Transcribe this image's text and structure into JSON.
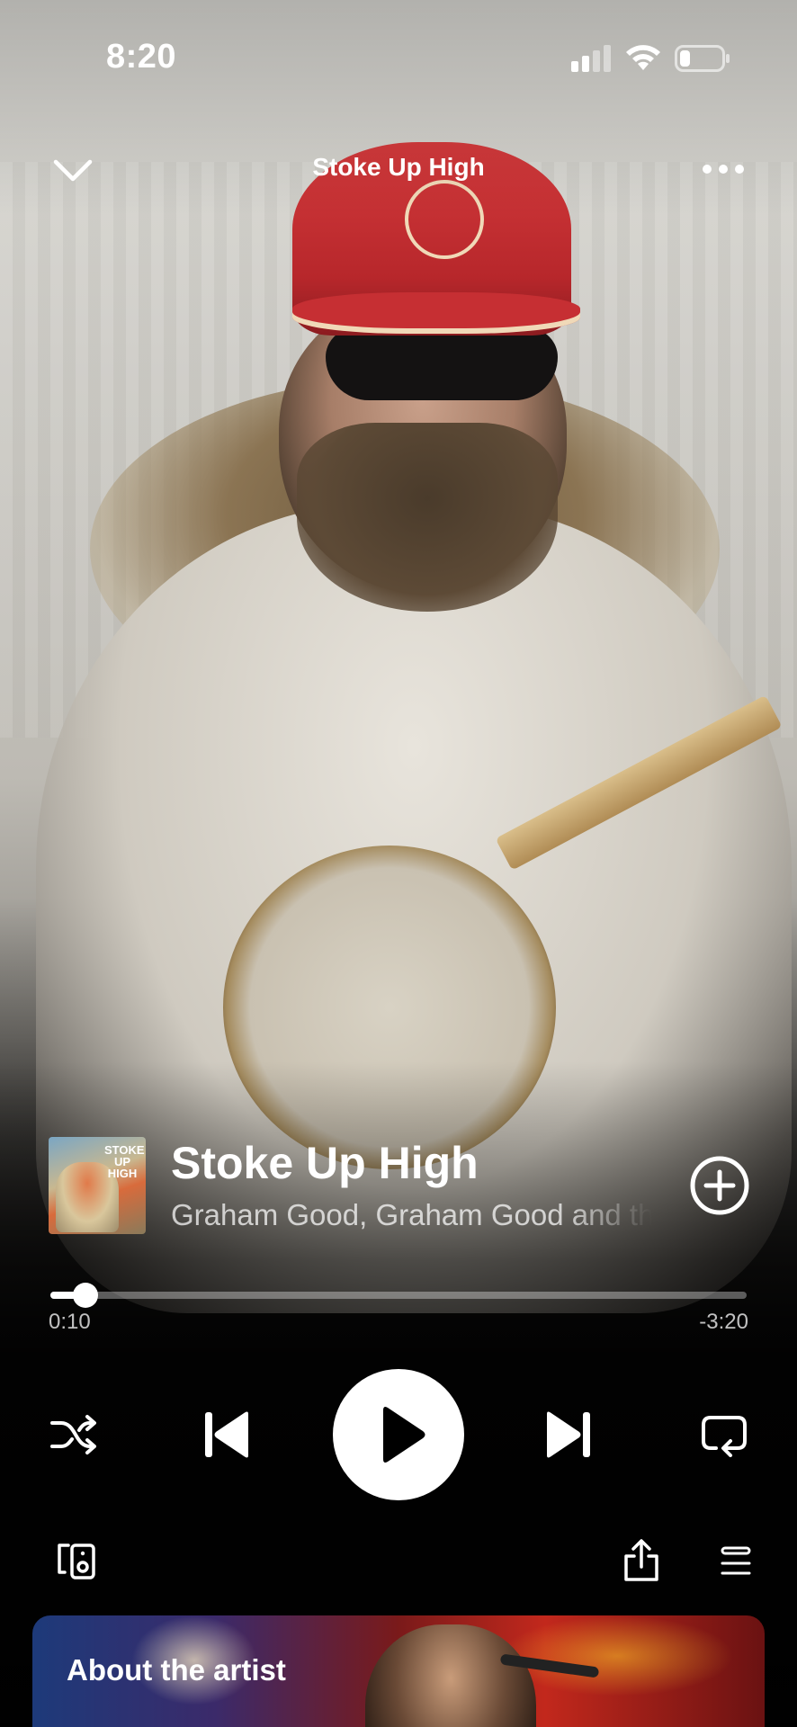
{
  "status_bar": {
    "time": "8:20",
    "signal_icon": "cellular-signal-icon",
    "wifi_icon": "wifi-icon",
    "battery_icon": "battery-icon",
    "battery_level": 0.25
  },
  "header": {
    "title": "Stoke Up High",
    "collapse_icon": "chevron-down-icon",
    "more_icon": "more-horizontal-icon"
  },
  "track": {
    "cover_text": "STOKE UP HIGH",
    "title": "Stoke Up High",
    "artist": "Graham Good, Graham Good and the Painters",
    "add_icon": "plus-circle-icon"
  },
  "progress": {
    "elapsed": "0:10",
    "remaining": "-3:20",
    "fraction": 0.05
  },
  "controls": {
    "shuffle_icon": "shuffle-icon",
    "previous_icon": "skip-previous-icon",
    "play_icon": "play-icon",
    "next_icon": "skip-next-icon",
    "repeat_icon": "repeat-icon"
  },
  "bottom_row": {
    "devices_icon": "connect-device-icon",
    "share_icon": "share-icon",
    "queue_icon": "queue-icon"
  },
  "about_card": {
    "title": "About the artist"
  },
  "colors": {
    "text": "#ffffff",
    "text_secondary": "#b8b8b8",
    "play_button": "#ffffff",
    "cap_red": "#c62f33"
  }
}
